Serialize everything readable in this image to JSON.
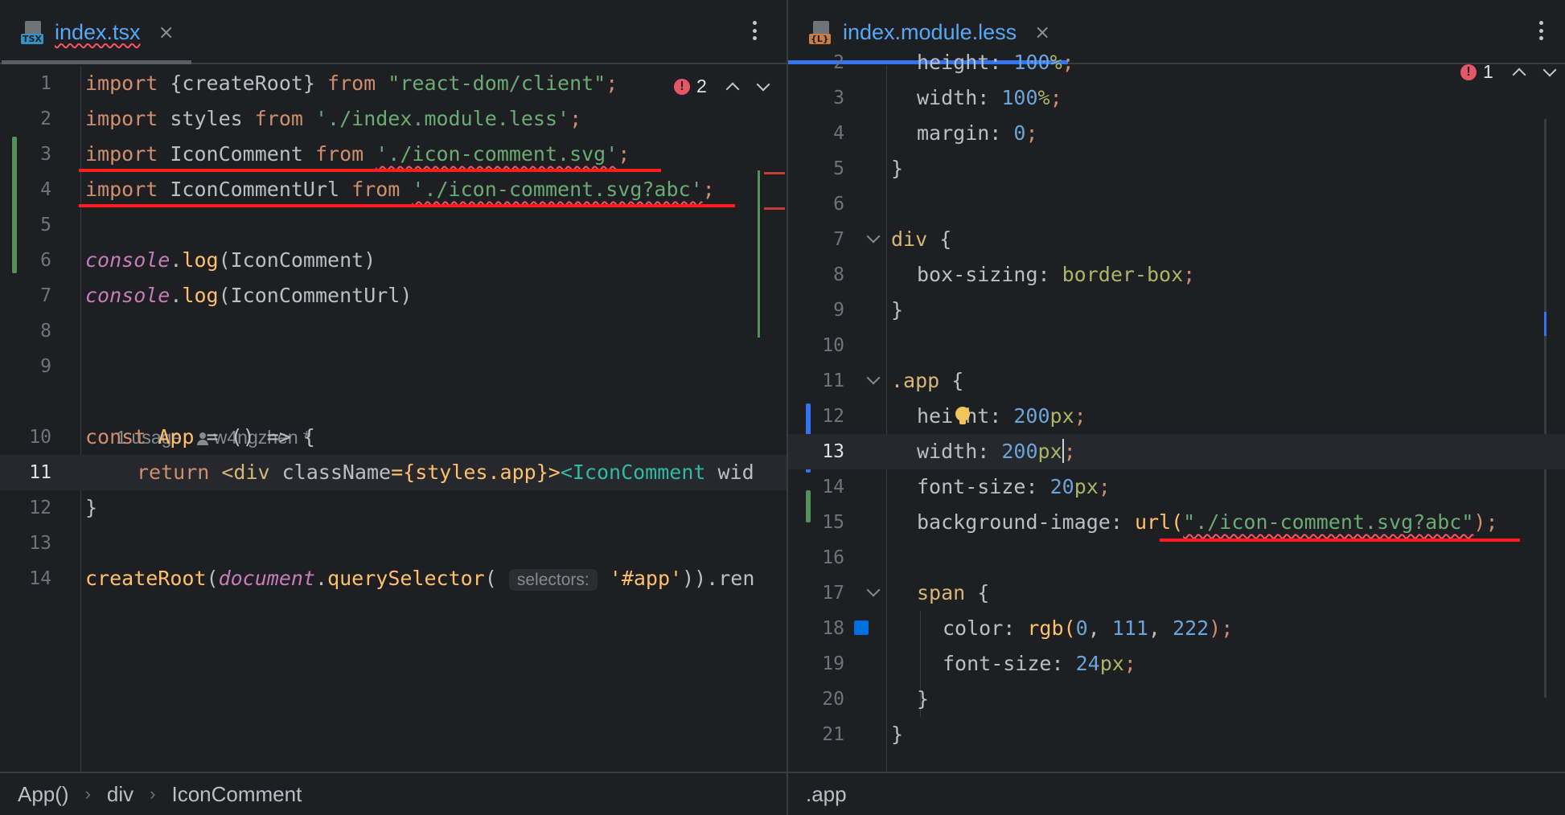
{
  "left": {
    "tab": {
      "name": "index.tsx",
      "badge": "TSX",
      "close": "×"
    },
    "inspection": {
      "count": "2"
    },
    "hint": {
      "usages": "1 usage",
      "author": "w4ngzhen *"
    },
    "lines": {
      "n1": "1",
      "n2": "2",
      "n3": "3",
      "n4": "4",
      "n5": "5",
      "n6": "6",
      "n7": "7",
      "n8": "8",
      "n9": "9",
      "n10": "10",
      "n11": "11",
      "n12": "12",
      "n13": "13",
      "n14": "14",
      "l1": {
        "a": "import ",
        "b": "{createRoot} ",
        "c": "from ",
        "d": "\"react-dom/client\"",
        "e": ";"
      },
      "l2": {
        "a": "import ",
        "b": "styles ",
        "c": "from ",
        "d": "'./index.module.less'",
        "e": ";"
      },
      "l3": {
        "a": "import ",
        "b": "IconComment ",
        "c": "from ",
        "d": "'./icon-comment.svg'",
        "e": ";"
      },
      "l4": {
        "a": "import ",
        "b": "IconCommentUrl ",
        "c": "from ",
        "d": "'./icon-comment.svg?abc'",
        "e": ";"
      },
      "l6": {
        "a": "console",
        "b": ".",
        "c": "log",
        "d": "(IconComment)"
      },
      "l7": {
        "a": "console",
        "b": ".",
        "c": "log",
        "d": "(IconCommentUrl)"
      },
      "l10": {
        "a": "const ",
        "b": "App",
        "c": " = () => {"
      },
      "l11": {
        "a": "return ",
        "b": "<div ",
        "c": "className",
        "d": "={styles.app}>",
        "e": "<IconComment ",
        "f": "wid"
      },
      "l12": {
        "a": "}"
      },
      "l14": {
        "a": "createRoot",
        "b": "(",
        "c": "document",
        "d": ".",
        "e": "querySelector",
        "f": "( ",
        "g": "selectors:",
        "h": " '#app'",
        "i": ")).ren"
      }
    },
    "breadcrumb": [
      "App()",
      "div",
      "IconComment"
    ]
  },
  "right": {
    "tab": {
      "name": "index.module.less",
      "badge": "{L}",
      "close": "×"
    },
    "inspection": {
      "count": "1"
    },
    "lines": {
      "n2": "2",
      "n3": "3",
      "n4": "4",
      "n5": "5",
      "n6": "6",
      "n7": "7",
      "n8": "8",
      "n9": "9",
      "n10": "10",
      "n11": "11",
      "n12": "12",
      "n13": "13",
      "n14": "14",
      "n15": "15",
      "n16": "16",
      "n17": "17",
      "n18": "18",
      "n19": "19",
      "n20": "20",
      "n21": "21",
      "l2": {
        "a": "height: ",
        "b": "100",
        "c": "%",
        "d": ";"
      },
      "l3": {
        "a": "width: ",
        "b": "100",
        "c": "%",
        "d": ";"
      },
      "l4": {
        "a": "margin: ",
        "b": "0",
        "c": ";"
      },
      "l5": {
        "a": "}"
      },
      "l7": {
        "a": "div ",
        "b": "{"
      },
      "l8": {
        "a": "box-sizing: ",
        "b": "border-box",
        "c": ";"
      },
      "l9": {
        "a": "}"
      },
      "l11": {
        "a": ".app ",
        "b": "{"
      },
      "l12": {
        "a": "hei",
        "b": "ht: ",
        "c": "200",
        "d": "px",
        "e": ";"
      },
      "l13": {
        "a": "width: ",
        "b": "200",
        "c": "px",
        "d": ";"
      },
      "l14": {
        "a": "font-size: ",
        "b": "20",
        "c": "px",
        "d": ";"
      },
      "l15": {
        "a": "background-image: ",
        "b": "url(",
        "c": "\"./icon-comment.svg?abc\"",
        "d": ");"
      },
      "l17": {
        "a": "span ",
        "b": "{"
      },
      "l18": {
        "a": "color: ",
        "b": "rgb(",
        "c": "0",
        "d": ", ",
        "e": "111",
        "f": ", ",
        "g": "222",
        "h": ");"
      },
      "l19": {
        "a": "font-size: ",
        "b": "24",
        "c": "px",
        "d": ";"
      },
      "l20": {
        "a": "}"
      },
      "l21": {
        "a": "}"
      }
    },
    "breadcrumb": [
      ".app"
    ]
  },
  "colors": {
    "accent": "#3574f0",
    "error": "#f75464",
    "annotation": "#ff1c1c",
    "vcs_added": "#549159",
    "swatch": "rgb(0,111,222)"
  },
  "icons": [
    "tsx-file-icon",
    "less-file-icon",
    "close-icon",
    "more-vertical-icon",
    "error-icon",
    "chevron-up-icon",
    "chevron-down-icon",
    "fold-icon",
    "lightbulb-icon",
    "user-icon",
    "color-swatch-icon"
  ]
}
